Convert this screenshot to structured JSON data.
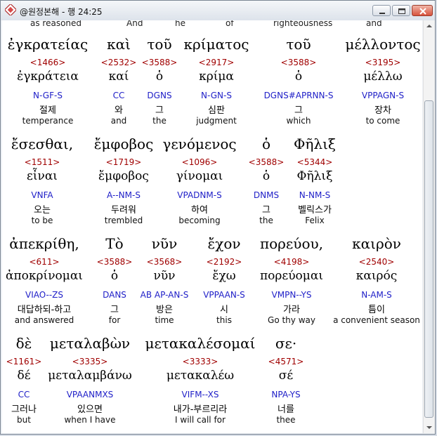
{
  "window": {
    "title": "@원정본해 - 행 24:25"
  },
  "top_partial": [
    "as reasoned",
    "And",
    "he",
    "of",
    "righteousness",
    "and"
  ],
  "rows": [
    [
      {
        "greek": "ἐγκρατείας",
        "strong": "<1466>",
        "lemma": "ἐγκράτεια",
        "morph": "N-GF-S",
        "korean": "절제",
        "english": "temperance"
      },
      {
        "greek": "καὶ",
        "strong": "<2532>",
        "lemma": "καί",
        "morph": "CC",
        "korean": "와",
        "english": "and"
      },
      {
        "greek": "τοῦ",
        "strong": "<3588>",
        "lemma": "ὁ",
        "morph": "DGNS",
        "korean": "그",
        "english": "the"
      },
      {
        "greek": "κρίματος",
        "strong": "<2917>",
        "lemma": "κρίμα",
        "morph": "N-GN-S",
        "korean": "심판",
        "english": "judgment"
      },
      {
        "greek": "τοῦ",
        "strong": "<3588>",
        "lemma": "ὁ",
        "morph": "DGNS#APRNN-S",
        "korean": "그",
        "english": "which"
      },
      {
        "greek": "μέλλοντος",
        "strong": "<3195>",
        "lemma": "μέλλω",
        "morph": "VPPAGN-S",
        "korean": "장차",
        "english": "to come"
      }
    ],
    [
      {
        "greek": "ἔσεσθαι,",
        "strong": "<1511>",
        "lemma": "εἶναι",
        "morph": "VNFA",
        "korean": "오는",
        "english": "to be"
      },
      {
        "greek": "ἔμφοβος",
        "strong": "<1719>",
        "lemma": "ἔμφοβος",
        "morph": "A--NM-S",
        "korean": "두려워",
        "english": "trembled"
      },
      {
        "greek": "γενόμενος",
        "strong": "<1096>",
        "lemma": "γίνομαι",
        "morph": "VPADNM-S",
        "korean": "하여",
        "english": "becoming"
      },
      {
        "greek": "ὁ",
        "strong": "<3588>",
        "lemma": "ὁ",
        "morph": "DNMS",
        "korean": "그",
        "english": "the"
      },
      {
        "greek": "Φῆλιξ",
        "strong": "<5344>",
        "lemma": "Φῆλιξ",
        "morph": "N-NM-S",
        "korean": "벨릭스가",
        "english": "Felix"
      }
    ],
    [
      {
        "greek": "ἀπεκρίθη,",
        "strong": "<611>",
        "lemma": "ἀποκρίνομαι",
        "morph": "VIAO--ZS",
        "korean": "대답하되-하고",
        "english": "and answered"
      },
      {
        "greek": "Τὸ",
        "strong": "<3588>",
        "lemma": "ὁ",
        "morph": "DANS",
        "korean": "그",
        "english": "for"
      },
      {
        "greek": "νῦν",
        "strong": "<3568>",
        "lemma": "νῦν",
        "morph": "AB AP-AN-S",
        "korean": "방은",
        "english": "time"
      },
      {
        "greek": "ἔχον",
        "strong": "<2192>",
        "lemma": "ἔχω",
        "morph": "VPPAAN-S",
        "korean": "시",
        "english": "this"
      },
      {
        "greek": "πορεύου,",
        "strong": "<4198>",
        "lemma": "πορεύομαι",
        "morph": "VMPN--YS",
        "korean": "가라",
        "english": "Go thy way"
      },
      {
        "greek": "καιρὸν",
        "strong": "<2540>",
        "lemma": "καιρός",
        "morph": "N-AM-S",
        "korean": "틈이",
        "english": "a convenient season"
      }
    ],
    [
      {
        "greek": "δὲ",
        "strong": "<1161>",
        "lemma": "δέ",
        "morph": "CC",
        "korean": "그러나",
        "english": "but"
      },
      {
        "greek": "μεταλαβὼν",
        "strong": "<3335>",
        "lemma": "μεταλαμβάνω",
        "morph": "VPAANMXS",
        "korean": "있으면",
        "english": "when I have"
      },
      {
        "greek": "μετακαλέσομαί",
        "strong": "<3333>",
        "lemma": "μετακαλέω",
        "morph": "VIFM--XS",
        "korean": "내가-부르리라",
        "english": "I will call for"
      },
      {
        "greek": "σε·",
        "strong": "<4571>",
        "lemma": "σέ",
        "morph": "NPA-YS",
        "korean": "너를",
        "english": "thee"
      }
    ]
  ]
}
